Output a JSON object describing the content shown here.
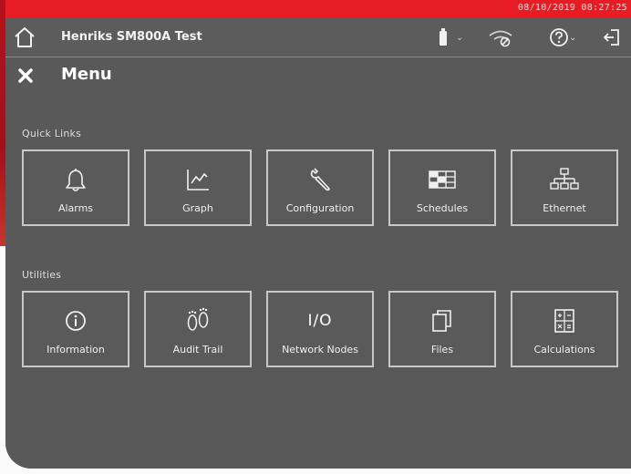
{
  "statusbar": {
    "datetime": "08/10/2019 08:27:25"
  },
  "titlebar": {
    "device_name": "Henriks SM800A Test",
    "icons": [
      "home-icon",
      "battery-icon",
      "chevron-down-icon",
      "network-disabled-icon",
      "help-icon",
      "chevron-down-icon",
      "logout-icon"
    ]
  },
  "menu": {
    "title": "Menu",
    "close_icon": "close-icon"
  },
  "sections": {
    "quick_links": {
      "label": "Quick Links",
      "tiles": [
        {
          "label": "Alarms",
          "icon": "bell-icon"
        },
        {
          "label": "Graph",
          "icon": "graph-icon"
        },
        {
          "label": "Configuration",
          "icon": "wrench-icon"
        },
        {
          "label": "Schedules",
          "icon": "schedule-grid-icon"
        },
        {
          "label": "Ethernet",
          "icon": "network-tree-icon"
        }
      ]
    },
    "utilities": {
      "label": "Utilities",
      "tiles": [
        {
          "label": "Information",
          "icon": "info-icon"
        },
        {
          "label": "Audit Trail",
          "icon": "footprints-icon"
        },
        {
          "label": "Network Nodes",
          "icon": "io-icon",
          "icon_text": "I/O"
        },
        {
          "label": "Files",
          "icon": "files-icon"
        },
        {
          "label": "Calculations",
          "icon": "calculator-icon"
        }
      ]
    }
  },
  "colors": {
    "screen_bg": "#595959",
    "statusbar_bg": "#e81c24",
    "bezel_red": "#b5121b",
    "tile_border": "#c8c8c8"
  }
}
